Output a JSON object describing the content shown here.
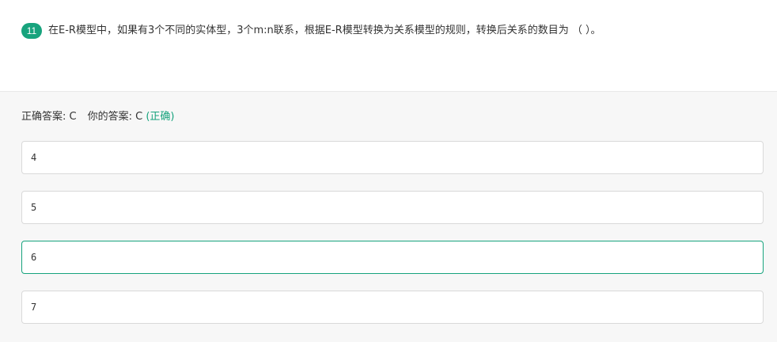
{
  "question": {
    "number": "11",
    "text": "在E-R模型中，如果有3个不同的实体型，3个m:n联系，根据E-R模型转换为关系模型的规则，转换后关系的数目为 （ ）。"
  },
  "answer": {
    "correct_label": "正确答案: C",
    "yours_label": "你的答案: C",
    "result": "(正确)"
  },
  "options": [
    {
      "text": "4",
      "selected": false
    },
    {
      "text": "5",
      "selected": false
    },
    {
      "text": "6",
      "selected": true
    },
    {
      "text": "7",
      "selected": false
    }
  ],
  "colors": {
    "accent": "#17a37d",
    "badge_bg": "#17a37d",
    "text": "#333333",
    "answer_bg": "#f7f7f7",
    "border": "#d9d9d9"
  }
}
